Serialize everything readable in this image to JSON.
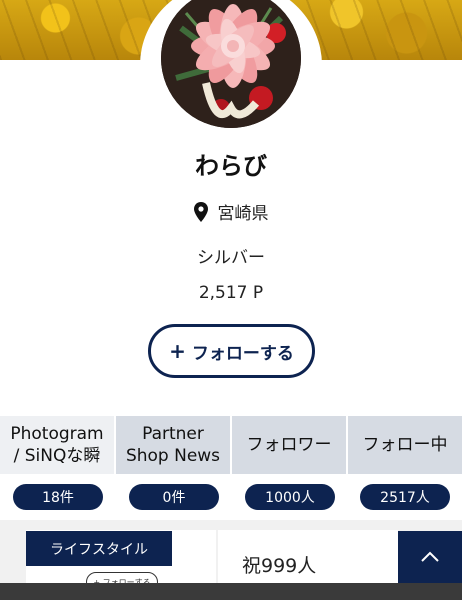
{
  "profile": {
    "username": "わらび",
    "location": "宮崎県",
    "rank": "シルバー",
    "points": "2,517 P",
    "follow_label": "フォローする",
    "follow_plus": "+"
  },
  "tabs": [
    {
      "label_line1": "Photogram",
      "label_line2": "/ SiNQな瞬",
      "count": "18件"
    },
    {
      "label_line1": "Partner",
      "label_line2": "Shop News",
      "count": "0件"
    },
    {
      "label_line1": "フォロワー",
      "label_line2": "",
      "count": "1000人"
    },
    {
      "label_line1": "フォロー中",
      "label_line2": "",
      "count": "2517人"
    }
  ],
  "post_card": {
    "category": "ライフスタイル",
    "follow_small": "+ フォローする",
    "title_preview": "祝999人"
  },
  "colors": {
    "navy": "#0d2350",
    "tab_bg": "#d6dbe3",
    "tab_active_bg": "#eef0f3",
    "header_gold": "#d7a815"
  },
  "icons": {
    "location": "map-pin-icon",
    "scroll_top": "chevron-up-icon"
  }
}
